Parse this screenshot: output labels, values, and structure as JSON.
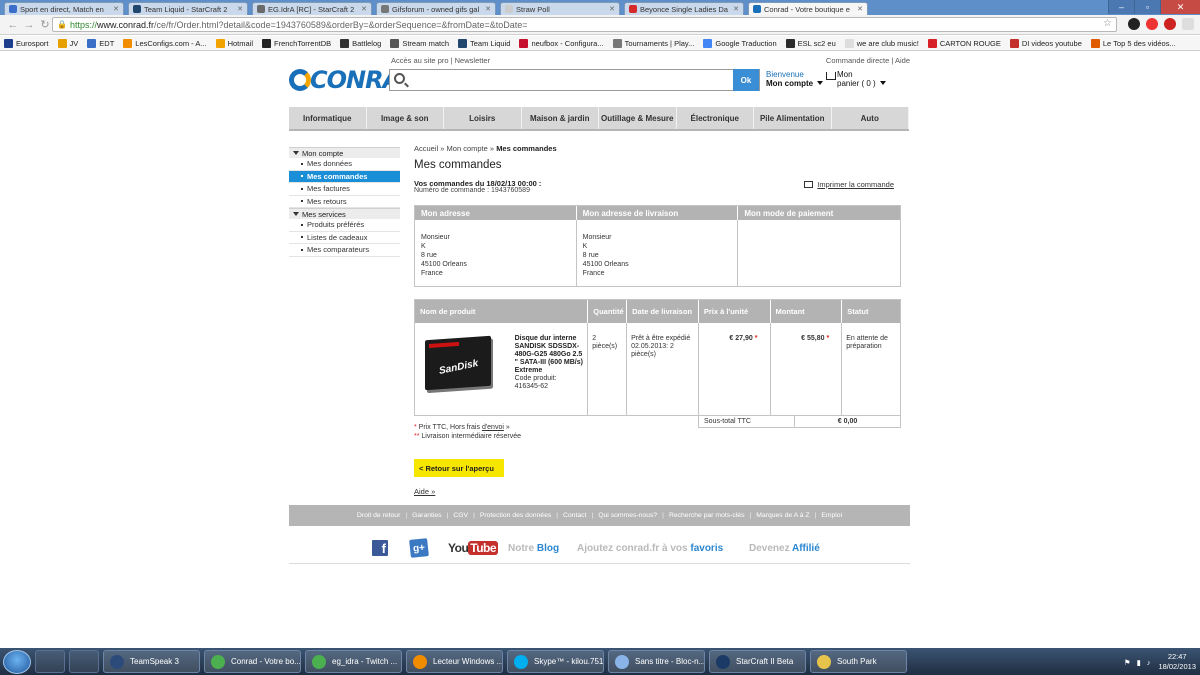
{
  "browser": {
    "tabs": [
      {
        "label": "Sport en direct, Match en",
        "color": "#3a6ec9"
      },
      {
        "label": "Team Liquid - StarCraft 2",
        "color": "#21476e"
      },
      {
        "label": "EG.IdrA [RC] - StarCraft 2",
        "color": "#6a6a6a"
      },
      {
        "label": "Gifsforum - owned gifs gal",
        "color": "#777777"
      },
      {
        "label": "Straw Poll",
        "color": "#cccccc"
      },
      {
        "label": "Beyonce Single Ladies Da",
        "color": "#d72b2b"
      },
      {
        "label": "Conrad - Votre boutique e",
        "color": "#1a70b8"
      }
    ],
    "url": {
      "scheme": "https://",
      "host": "www.conrad.fr",
      "path": "/ce/fr/Order.html?detail&code=1943760589&orderBy=&orderSequence=&fromDate=&toDate="
    },
    "bookmarks": [
      {
        "label": "Eurosport",
        "color": "#1d3e8c"
      },
      {
        "label": "JV",
        "color": "#e6a000"
      },
      {
        "label": "EDT",
        "color": "#3a6ec9"
      },
      {
        "label": "LesConfigs.com - A...",
        "color": "#f28c00"
      },
      {
        "label": "Hotmail",
        "color": "#f2a300"
      },
      {
        "label": "FrenchTorrentDB",
        "color": "#222222"
      },
      {
        "label": "Battlelog",
        "color": "#333333"
      },
      {
        "label": "Stream match",
        "color": "#555555"
      },
      {
        "label": "Team Liquid",
        "color": "#21476e"
      },
      {
        "label": "neufbox - Configura...",
        "color": "#c8102e"
      },
      {
        "label": "Tournaments | Play...",
        "color": "#777777"
      },
      {
        "label": "Google Traduction",
        "color": "#4285f4"
      },
      {
        "label": "ESL sc2 eu",
        "color": "#2b2b2b"
      },
      {
        "label": "we are club music!",
        "color": "#dddddd"
      },
      {
        "label": "CARTON ROUGE",
        "color": "#d61f26"
      },
      {
        "label": "DI videos youtube",
        "color": "#c4302b"
      },
      {
        "label": "Le Top 5 des vidéos...",
        "color": "#e05a00"
      }
    ]
  },
  "header": {
    "logo": "CONRAD",
    "top_left_links": "Accès au site pro | Newsletter",
    "top_right_links": "Commande directe | Aide",
    "search_button": "Ok",
    "welcome_line1": "Bienvenue",
    "welcome_line2": "Mon compte",
    "cart_line1": "Mon",
    "cart_line2": "panier ( 0 )"
  },
  "nav": [
    "Informatique",
    "Image & son",
    "Loisirs",
    "Maison & jardin",
    "Outillage & Mesure",
    "Électronique",
    "Pile Alimentation",
    "Auto"
  ],
  "leftmenu": {
    "section1": "Mon compte",
    "items1": [
      "Mes données",
      "Mes commandes",
      "Mes factures",
      "Mes retours"
    ],
    "section2": "Mes services",
    "items2": [
      "Produits préférés",
      "Listes de cadeaux",
      "Mes comparateurs"
    ]
  },
  "content": {
    "breadcrumb": [
      "Accueil",
      "»",
      "Mon compte",
      "»",
      "Mes commandes"
    ],
    "title": "Mes commandes",
    "order_date": "Vos commandes du 18/02/13 00:00 :",
    "order_number": "Numéro de commande : 1943760589",
    "print_link": "Imprimer la commande",
    "address_headers": [
      "Mon adresse",
      "Mon adresse de livraison",
      "Mon mode de paiement"
    ],
    "address": [
      "Monsieur",
      "K",
      "8 rue",
      "45100 Orleans",
      "France"
    ],
    "delivery_address": [
      "Monsieur",
      "K",
      "8 rue",
      "45100 Orleans",
      "France"
    ],
    "product_headers": [
      "Nom de produit",
      "Quantité",
      "Date de livraison",
      "Prix à l'unité",
      "Montant",
      "Statut"
    ],
    "product": {
      "image_brand": "SanDisk",
      "name": "Disque dur interne SANDISK SDSSDX-480G-G25 480Go 2.5 \" SATA-III (600 MB/s) Extreme",
      "code": "Code produit: 416345-62",
      "quantity": "2 pièce(s)",
      "delivery": "Prêt à être expédié 02.05.2013: 2 pièce(s)",
      "unit_price": "€ 27,90",
      "amount": "€ 55,80",
      "status": "En attente de préparation"
    },
    "subtotal_label": "Sous-total TTC",
    "subtotal_value": "€ 0,00",
    "note1_prefix": "Prix TTC, Hors frais ",
    "note1_link": "d'envoi",
    "note1_suffix": " »",
    "note2": "Livraison intermédiaire réservée",
    "back_button": "< Retour sur l'aperçu",
    "help_link": "Aide »"
  },
  "footer": {
    "links": [
      "Droit de retour",
      "Garanties",
      "CGV",
      "Protection des données",
      "Contact",
      "Qui sommes-nous?",
      "Recherche par mots-clés",
      "Marques de A à Z",
      "Emploi"
    ],
    "youtube_you": "You",
    "youtube_tube": "Tube",
    "blog_pre": "Notre ",
    "blog_hl": "Blog",
    "fav_pre": "Ajoutez conrad.fr à vos ",
    "fav_hl": "favoris",
    "aff_pre": "Devenez ",
    "aff_hl": "Affilié"
  },
  "taskbar": {
    "items": [
      {
        "label": "TeamSpeak 3",
        "color": "#2c4a7a"
      },
      {
        "label": "Conrad - Votre bo...",
        "color": "#4caf50"
      },
      {
        "label": "eg_idra - Twitch ...",
        "color": "#4caf50"
      },
      {
        "label": "Lecteur Windows ...",
        "color": "#f08c00"
      },
      {
        "label": "Skype™ - kilou.751",
        "color": "#00aff0"
      },
      {
        "label": "Sans titre - Bloc-n...",
        "color": "#8ab4e8"
      },
      {
        "label": "StarCraft II Beta",
        "color": "#1c3a66"
      },
      {
        "label": "South Park",
        "color": "#e6c34a"
      }
    ],
    "time": "22:47",
    "date": "18/02/2013"
  }
}
